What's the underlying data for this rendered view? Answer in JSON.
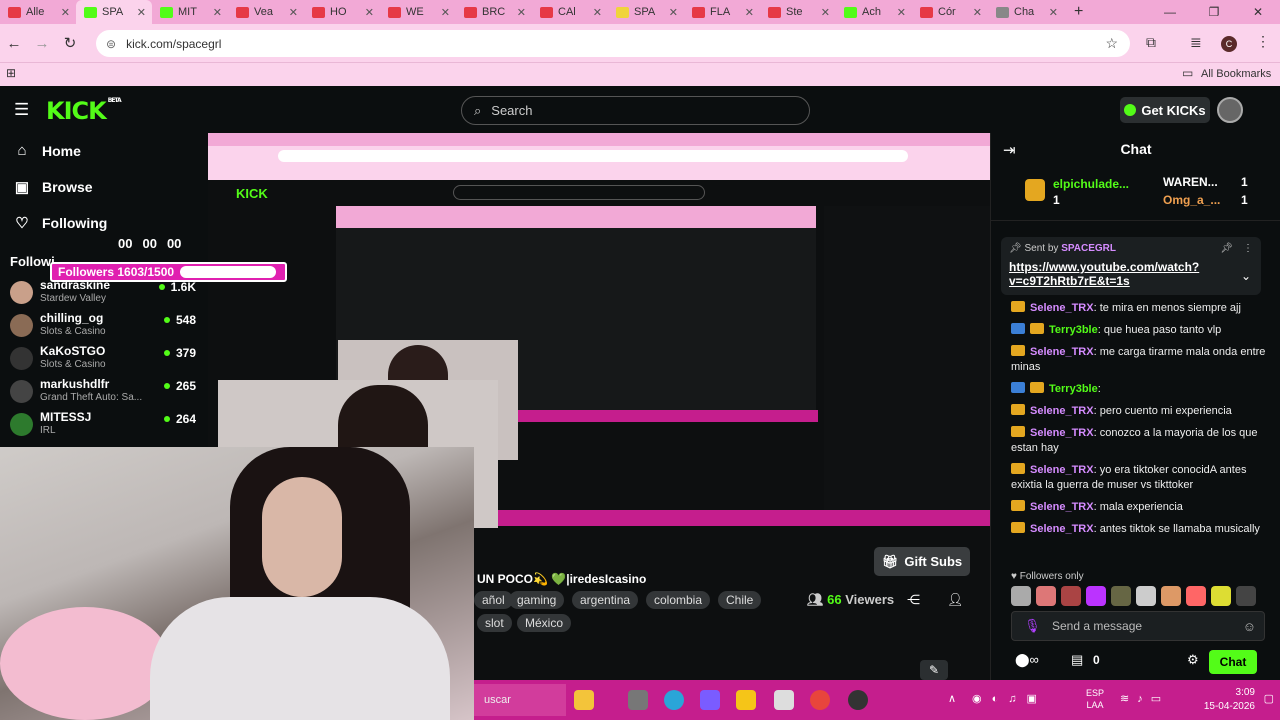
{
  "browser": {
    "tabs": [
      {
        "label": "Alle",
        "color": "#e63946"
      },
      {
        "label": "SPA",
        "color": "#53fc18",
        "active": true
      },
      {
        "label": "MIT",
        "color": "#53fc18"
      },
      {
        "label": "Vea",
        "color": "#e63946"
      },
      {
        "label": "HO",
        "color": "#e63946"
      },
      {
        "label": "WE",
        "color": "#e63946"
      },
      {
        "label": "BRC",
        "color": "#e63946"
      },
      {
        "label": "CAl",
        "color": "#e63946"
      },
      {
        "label": "SPA",
        "color": "#f0d43a"
      },
      {
        "label": "FLA",
        "color": "#e63946"
      },
      {
        "label": "Ste",
        "color": "#e63946"
      },
      {
        "label": "Ach",
        "color": "#53fc18"
      },
      {
        "label": "Cór",
        "color": "#e63946"
      },
      {
        "label": "Cha",
        "color": "#888888"
      }
    ],
    "new_tab": "+",
    "url": "kick.com/spacegrl",
    "profile_initial": "C",
    "bookmarks_label": "All Bookmarks"
  },
  "kick": {
    "logo": "KICK",
    "logo_badge": "BETA",
    "search_placeholder": "Search",
    "get_kicks": "Get KICKs"
  },
  "sidebar": {
    "nav": [
      {
        "label": "Home",
        "icon": "home-icon"
      },
      {
        "label": "Browse",
        "icon": "browse-icon"
      },
      {
        "label": "Following",
        "icon": "heart-icon"
      }
    ],
    "section_title": "Followi",
    "channels": [
      {
        "name": "sandraskine",
        "category": "Stardew Valley",
        "viewers": "1.6K",
        "color": "#c9a08a"
      },
      {
        "name": "chilling_og",
        "category": "Slots & Casino",
        "viewers": "548",
        "color": "#8a6b55"
      },
      {
        "name": "KaKoSTGO",
        "category": "Slots & Casino",
        "viewers": "379",
        "color": "#333333"
      },
      {
        "name": "markushdlfr",
        "category": "Grand Theft Auto: Sa...",
        "viewers": "265",
        "color": "#444444"
      },
      {
        "name": "MITESSJ",
        "category": "IRL",
        "viewers": "264",
        "color": "#2d7a2d"
      }
    ]
  },
  "overlay": {
    "counters": [
      "00",
      "00",
      "00"
    ],
    "followers_label": "Followers 1603/1500"
  },
  "stream": {
    "title": "UN POCO💫 💚|iredesIcasino",
    "tags": [
      "añol",
      "gaming",
      "argentina",
      "colombia",
      "Chile",
      "slot",
      "México"
    ],
    "viewers_count": "66",
    "viewers_label": "Viewers",
    "gift_subs": "Gift Subs"
  },
  "taskbar": {
    "search": "uscar",
    "lang": "ESP",
    "lang_sub": "LAA",
    "time": "3:09",
    "date": "15-04-2026"
  },
  "chat": {
    "header": "Chat",
    "leaderboard": [
      {
        "name": "elpichulade...",
        "value": "1"
      },
      {
        "name": "WAREN...",
        "value": "1"
      },
      {
        "name": "Omg_a_...",
        "value": "1"
      }
    ],
    "pinned_sent_by": "Sent by",
    "pinned_user": "SPACEGRL",
    "pinned_link": "https://www.youtube.com/watch?v=c9T2hRtb7rE&t=1s",
    "messages": [
      {
        "user": "Selene_TRX",
        "text": "te mira en menos siempre ajj",
        "style": "p"
      },
      {
        "user": "Terry3ble",
        "text": "que huea paso tanto vlp",
        "style": "g"
      },
      {
        "user": "Selene_TRX",
        "text": "me carga tirarme mala onda entre minas",
        "style": "p"
      },
      {
        "user": "Terry3ble",
        "text": "",
        "style": "g"
      },
      {
        "user": "Selene_TRX",
        "text": "pero cuento mi experiencia",
        "style": "p"
      },
      {
        "user": "Selene_TRX",
        "text": "conozco a la mayoria de los que estan hay",
        "style": "p"
      },
      {
        "user": "Selene_TRX",
        "text": "yo era tiktoker conocidA antes exixtia la guerra de muser vs tikttoker",
        "style": "p"
      },
      {
        "user": "Selene_TRX",
        "text": "mala experiencia",
        "style": "p"
      },
      {
        "user": "Selene_TRX",
        "text": "antes tiktok se llamaba musically",
        "style": "p"
      }
    ],
    "followers_only": "Followers only",
    "send_placeholder": "Send a message",
    "kicks_count": "0",
    "chat_button": "Chat"
  }
}
